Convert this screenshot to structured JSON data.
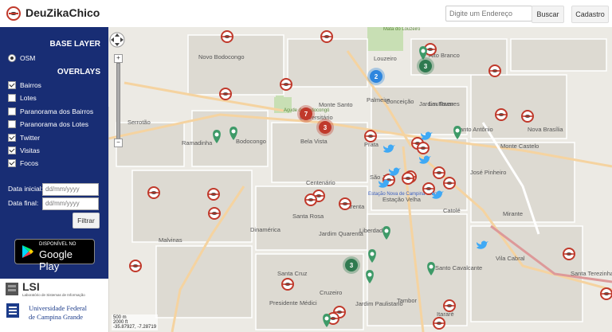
{
  "header": {
    "title": "DeuZikaChico",
    "search_placeholder": "Digite um Endereço",
    "search_button": "Buscar",
    "register_button": "Cadastro"
  },
  "sidebar": {
    "base_layer_title": "BASE LAYER",
    "base_layer_option": "OSM",
    "overlays_title": "OVERLAYS",
    "overlays": [
      {
        "label": "Bairros",
        "checked": true
      },
      {
        "label": "Lotes",
        "checked": false
      },
      {
        "label": "Paranorama dos Bairros",
        "checked": false
      },
      {
        "label": "Paranorama dos Lotes",
        "checked": false
      },
      {
        "label": "Twitter",
        "checked": true
      },
      {
        "label": "Visitas",
        "checked": true
      },
      {
        "label": "Focos",
        "checked": true
      }
    ],
    "date_start_label": "Data inicial:",
    "date_end_label": "Data final:",
    "date_placeholder": "dd/mm/yyyy",
    "filter_button": "Filtrar",
    "gplay_small": "DISPONÍVEL NO",
    "gplay_big": "Google Play",
    "lsi_name": "LSI",
    "lsi_subtitle": "Laboratório de Sistemas de Informação",
    "university_line1": "Universidade Federal",
    "university_line2": "de Campina Grande"
  },
  "map": {
    "zoom_in": "+",
    "zoom_out": "−",
    "scale_m": "500 m",
    "scale_ft": "2000 ft",
    "coords": "-35.87927, -7.28719",
    "neighborhoods": [
      "Novo Bodocongo",
      "Bodocongo",
      "Ramadinha",
      "Serrotão",
      "Malvinas",
      "Dinamérica",
      "Santa Rosa",
      "Centenário",
      "Quarenta",
      "Jardim Quarenta",
      "Santa Cruz",
      "Presidente Médici",
      "Cruzeiro",
      "Jardim Paulistano",
      "Tambor",
      "Liberdade",
      "Catolé",
      "Itararé",
      "Santo Antônio",
      "Monte Castelo",
      "José Pinheiro",
      "Nova Brasília",
      "Mirante",
      "Vila Cabral",
      "Santa Terezinha",
      "Santo Cavalcante",
      "Palmeira",
      "Conceição",
      "Jardim Tavares",
      "Louzeiro",
      "Monte Santo",
      "Prata",
      "São José",
      "Estação Velha",
      "Bela Vista",
      "Universitário",
      "Alto Branco",
      "Lauritzen",
      "Estação Nova de Campina Grande",
      "Mata do Louzeiro",
      "Açude de Bodocongó"
    ],
    "clusters": [
      {
        "count": "7",
        "color": "#c0392b"
      },
      {
        "count": "3",
        "color": "#c0392b"
      },
      {
        "count": "2",
        "color": "#2e86de"
      },
      {
        "count": "3",
        "color": "#2f7a50"
      },
      {
        "count": "3",
        "color": "#2f7a50"
      }
    ]
  }
}
